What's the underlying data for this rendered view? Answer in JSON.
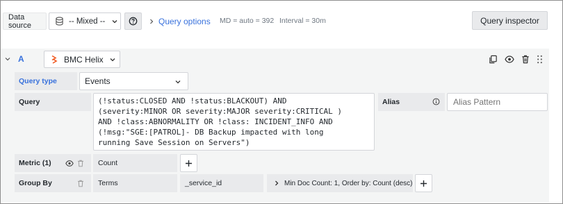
{
  "toolbar": {
    "datasource_label": "Data source",
    "datasource_value": "-- Mixed --",
    "query_options_label": "Query options",
    "md_text": "MD = auto = 392",
    "interval_text": "Interval = 30m",
    "inspector_label": "Query inspector"
  },
  "query": {
    "ref_id": "A",
    "datasource_name": "BMC Helix",
    "query_type_label": "Query type",
    "query_type_value": "Events",
    "query_label": "Query",
    "query_text": "(!status:CLOSED AND !status:BLACKOUT) AND\n(severity:MINOR OR severity:MAJOR severity:CRITICAL )\nAND !class:ABNORMALITY OR !class: INCIDENT_INFO AND\n(!msg:\"SGE:[PATROL]- DB Backup impacted with long\nrunning Save Session on Servers\")",
    "alias_label": "Alias",
    "alias_placeholder": "Alias Pattern",
    "metric_label": "Metric (1)",
    "metric_value": "Count",
    "groupby_label": "Group By",
    "groupby_type": "Terms",
    "groupby_field": "_service_id",
    "groupby_options": "Min Doc Count: 1, Order by: Count (desc)"
  },
  "colors": {
    "accent": "#3871dc",
    "helix_orange": "#f15a22"
  }
}
